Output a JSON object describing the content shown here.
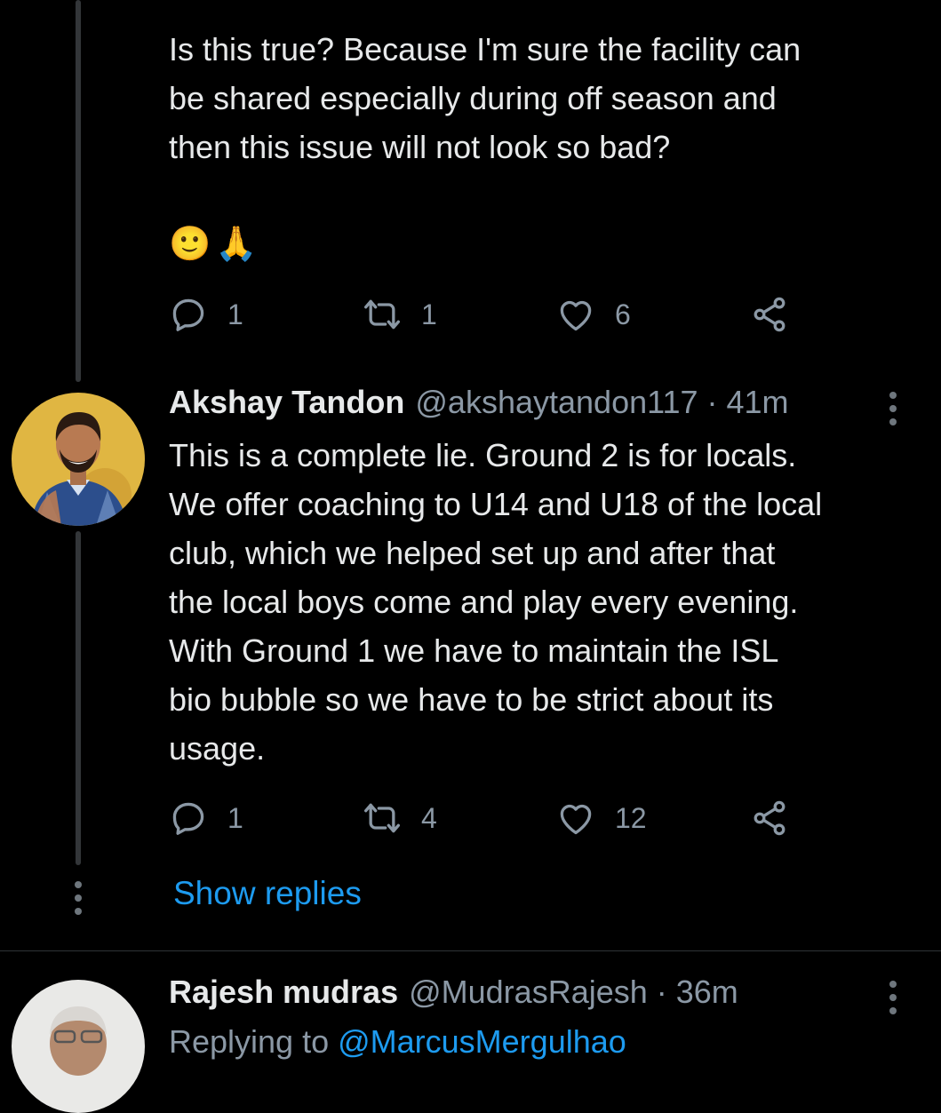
{
  "tweet1": {
    "text": "Is this true? Because I'm sure the facility can\nbe shared especially during off season and\nthen this issue will not look so bad?",
    "emoji_1": "🙂",
    "emoji_2": "🙏",
    "actions": {
      "replies": "1",
      "retweets": "1",
      "likes": "6"
    }
  },
  "tweet2": {
    "name": "Akshay Tandon",
    "handle": "@akshaytandon117",
    "separator": "·",
    "time": "41m",
    "text": "This is a complete lie. Ground 2 is for locals.\nWe offer coaching to U14 and U18 of the local\nclub, which we helped set up and after that\nthe local boys come and play every evening.\nWith Ground 1 we have to maintain the ISL\nbio bubble so we have to be strict about its\nusage.",
    "actions": {
      "replies": "1",
      "retweets": "4",
      "likes": "12"
    },
    "show_replies": "Show replies"
  },
  "tweet3": {
    "name": "Rajesh mudras",
    "handle": "@MudrasRajesh",
    "separator": "·",
    "time": "36m",
    "replying_prefix": "Replying to ",
    "replying_mention": "@MarcusMergulhao"
  },
  "colors": {
    "background": "#000000",
    "text": "#e7e9ea",
    "secondary": "#8b98a5",
    "link": "#1d9bf0",
    "thread_line": "#333639"
  },
  "icons": [
    "reply-icon",
    "retweet-icon",
    "like-icon",
    "share-icon",
    "more-icon"
  ]
}
